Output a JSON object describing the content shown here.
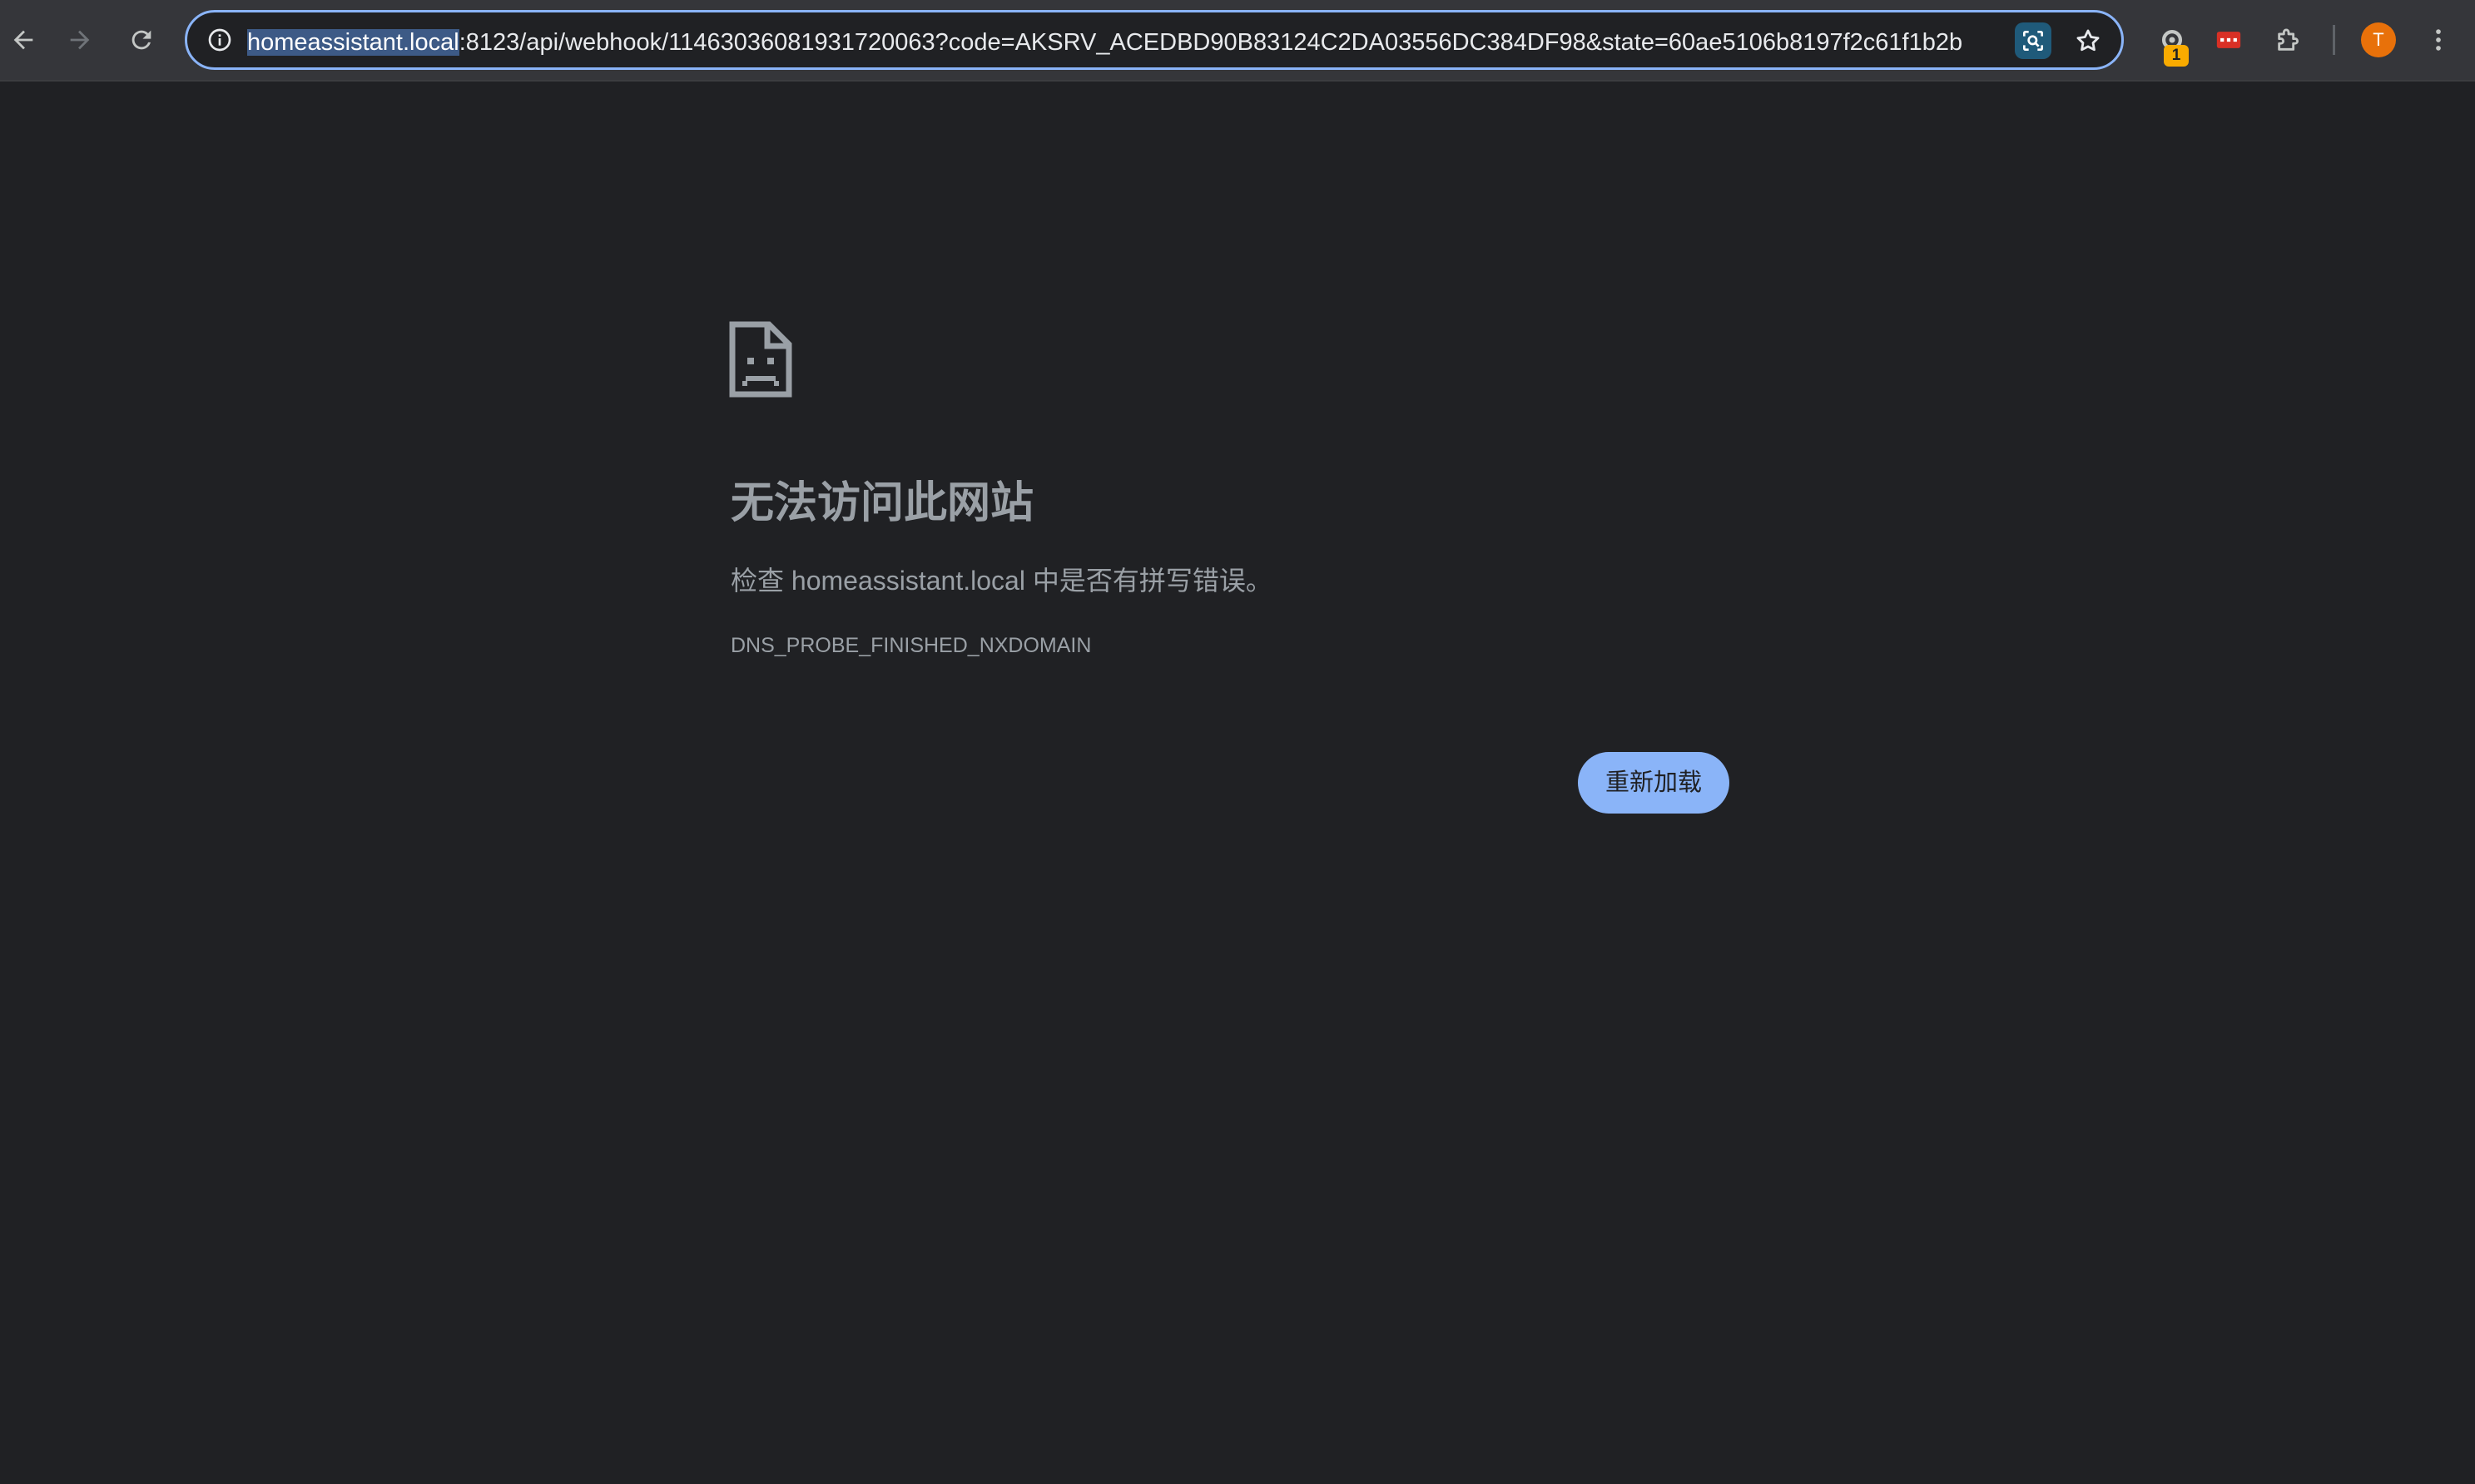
{
  "browser": {
    "address_bar": {
      "url_host": "homeassistant.local",
      "url_rest": ":8123/api/webhook/11463036081931720063?code=AKSRV_ACEDBD90B83124C2DA03556DC384DF98&state=60ae5106b8197f2c61f1b2b"
    },
    "extension_badge_count": "1",
    "profile_avatar_letter": "T"
  },
  "error_page": {
    "title": "无法访问此网站",
    "description": "检查 homeassistant.local 中是否有拼写错误。",
    "error_code": "DNS_PROBE_FINISHED_NXDOMAIN",
    "reload_button_label": "重新加载"
  },
  "colors": {
    "page_background": "#202124",
    "toolbar_background": "#35363a",
    "accent": "#8ab4f8",
    "text_secondary": "#9aa0a6",
    "avatar": "#e8710a"
  }
}
